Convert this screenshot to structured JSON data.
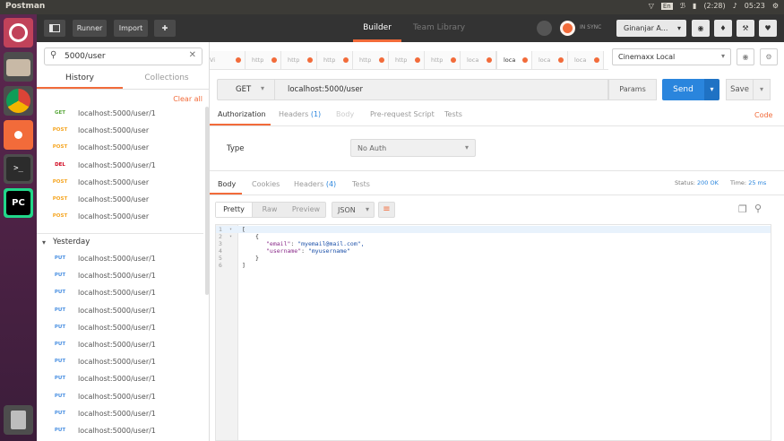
{
  "system_bar": {
    "app_name": "Postman",
    "keyboard_layout": "En",
    "battery": "(2:28)",
    "clock": "05:23"
  },
  "toolbar": {
    "runner": "Runner",
    "import": "Import",
    "tab_builder": "Builder",
    "tab_team_library": "Team Library",
    "sync_status": "IN SYNC",
    "user_name": "Ginanjar A..."
  },
  "sidebar": {
    "search_value": "5000/user",
    "tab_history": "History",
    "tab_collections": "Collections",
    "clear_all": "Clear all",
    "today_items": [
      {
        "method": "GET",
        "url": "localhost:5000/user/1"
      },
      {
        "method": "POST",
        "url": "localhost:5000/user"
      },
      {
        "method": "POST",
        "url": "localhost:5000/user"
      },
      {
        "method": "DEL",
        "url": "localhost:5000/user/1"
      },
      {
        "method": "POST",
        "url": "localhost:5000/user"
      },
      {
        "method": "POST",
        "url": "localhost:5000/user"
      },
      {
        "method": "POST",
        "url": "localhost:5000/user"
      }
    ],
    "yesterday_label": "Yesterday",
    "yesterday_items": [
      {
        "method": "PUT",
        "url": "localhost:5000/user/1"
      },
      {
        "method": "PUT",
        "url": "localhost:5000/user/1"
      },
      {
        "method": "PUT",
        "url": "localhost:5000/user/1"
      },
      {
        "method": "PUT",
        "url": "localhost:5000/user/1"
      },
      {
        "method": "PUT",
        "url": "localhost:5000/user/1"
      },
      {
        "method": "PUT",
        "url": "localhost:5000/user/1"
      },
      {
        "method": "PUT",
        "url": "localhost:5000/user/1"
      },
      {
        "method": "PUT",
        "url": "localhost:5000/user/1"
      },
      {
        "method": "PUT",
        "url": "localhost:5000/user/1"
      },
      {
        "method": "PUT",
        "url": "localhost:5000/user/1"
      },
      {
        "method": "PUT",
        "url": "localhost:5000/user/1"
      }
    ]
  },
  "request_tabs": [
    "Vi",
    "http",
    "http",
    "http",
    "http",
    "http",
    "http",
    "loca",
    "loca",
    "loca",
    "loca"
  ],
  "environment": "Cinemaxx Local",
  "request": {
    "method": "GET",
    "url": "localhost:5000/user",
    "params": "Params",
    "send": "Send",
    "save": "Save"
  },
  "request_subtabs": {
    "authorization": "Authorization",
    "headers": "Headers",
    "headers_count": "(1)",
    "body": "Body",
    "pre_request": "Pre-request Script",
    "tests": "Tests",
    "code": "Code"
  },
  "auth": {
    "type_label": "Type",
    "type_value": "No Auth"
  },
  "response": {
    "tab_body": "Body",
    "tab_cookies": "Cookies",
    "tab_headers": "Headers",
    "headers_count": "(4)",
    "tab_tests": "Tests",
    "status_label": "Status:",
    "status_value": "200 OK",
    "time_label": "Time:",
    "time_value": "25 ms",
    "view_pretty": "Pretty",
    "view_raw": "Raw",
    "view_preview": "Preview",
    "format": "JSON",
    "lines": [
      {
        "n": "1",
        "text": "["
      },
      {
        "n": "2",
        "text": "{"
      },
      {
        "n": "3",
        "key": "\"email\"",
        "value": "\"myemail@mail.com\","
      },
      {
        "n": "4",
        "key": "\"username\"",
        "value": "\"myusername\""
      },
      {
        "n": "5",
        "text": "}"
      },
      {
        "n": "6",
        "text": "]"
      }
    ]
  },
  "colors": {
    "accent": "#f26b3a",
    "send_blue": "#2a85dd",
    "get_green": "#5aa83c",
    "post_orange": "#f5a623",
    "del_red": "#d0021b",
    "put_blue": "#4a90e2",
    "launcher_purple": "#5e2750"
  }
}
